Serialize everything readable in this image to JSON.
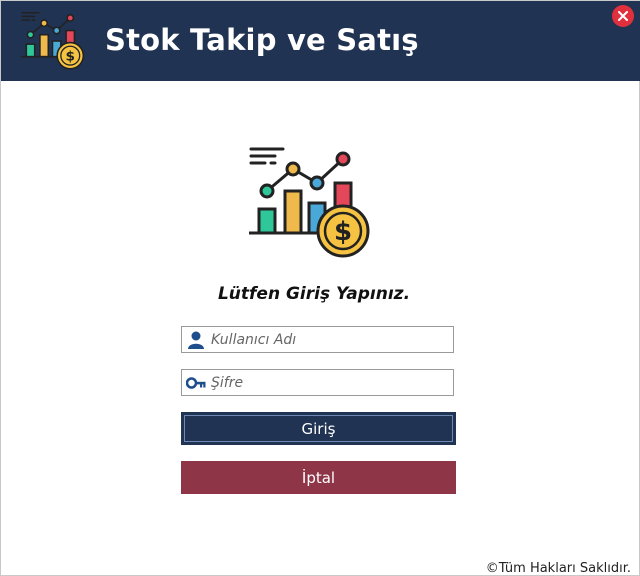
{
  "window": {
    "title": "Stok Takip ve Satış",
    "close_icon": "close-icon"
  },
  "login": {
    "prompt": "Lütfen Giriş Yapınız.",
    "username": {
      "placeholder": "Kullanıcı Adı",
      "value": "",
      "icon": "user-icon"
    },
    "password": {
      "placeholder": "Şifre",
      "value": "",
      "icon": "key-icon"
    },
    "login_button": "Giriş",
    "cancel_button": "İptal"
  },
  "footer": {
    "copyright": "©Tüm Hakları Saklıdır."
  },
  "colors": {
    "header_bg": "#213352",
    "login_button": "#213352",
    "cancel_button": "#8e3647",
    "close_button": "#e0303e",
    "coin": "#f5c242",
    "bar_green": "#2fc79a",
    "bar_yellow": "#f0b94b",
    "bar_blue": "#4aa8d8",
    "bar_red": "#e5475a"
  }
}
